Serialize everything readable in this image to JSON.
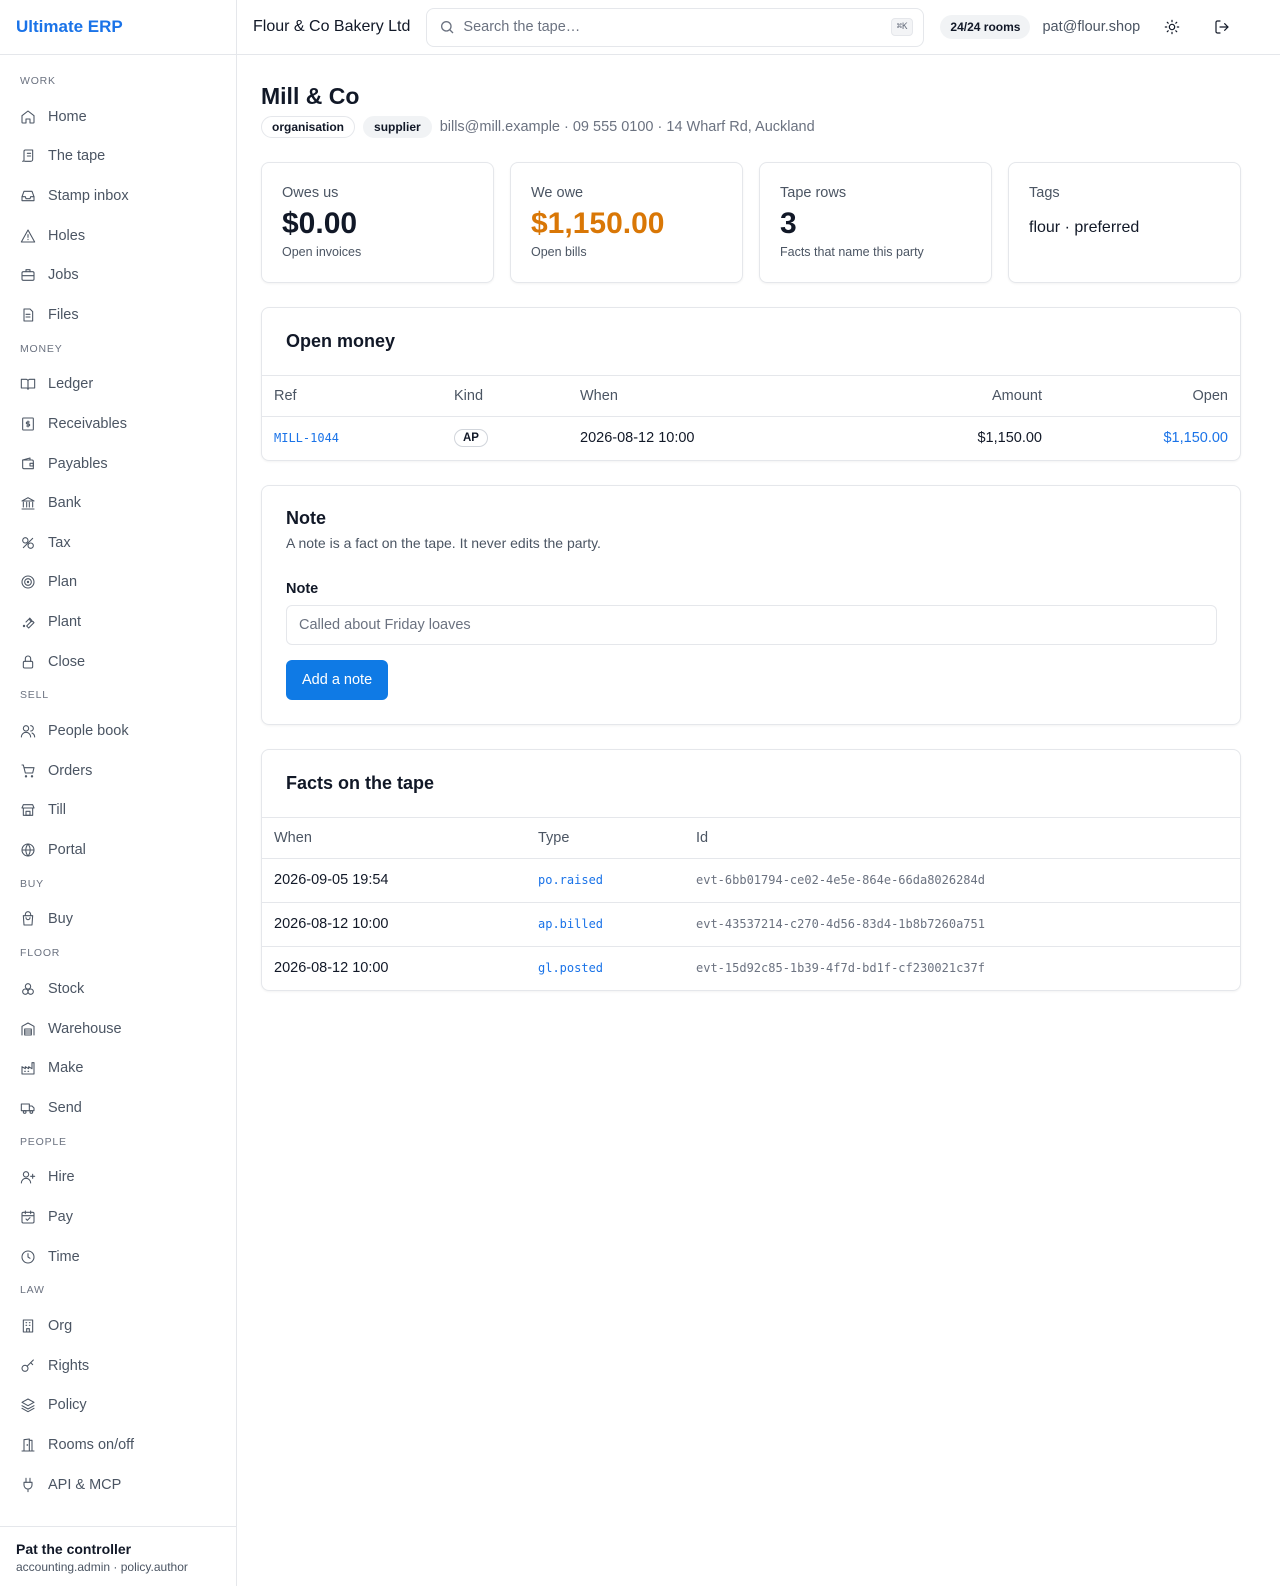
{
  "app": {
    "brand": "Ultimate ERP"
  },
  "topbar": {
    "company": "Flour & Co Bakery Ltd",
    "search_placeholder": "Search the tape…",
    "search_shortcut": "⌘K",
    "rooms_badge": "24/24 rooms",
    "email": "pat@flour.shop"
  },
  "sidebar": {
    "sections": [
      {
        "title": "WORK",
        "items": [
          {
            "label": "Home",
            "icon": "home-icon"
          },
          {
            "label": "The tape",
            "icon": "scroll-icon"
          },
          {
            "label": "Stamp inbox",
            "icon": "inbox-icon"
          },
          {
            "label": "Holes",
            "icon": "warning-triangle-icon"
          },
          {
            "label": "Jobs",
            "icon": "briefcase-icon"
          },
          {
            "label": "Files",
            "icon": "file-icon"
          }
        ]
      },
      {
        "title": "MONEY",
        "items": [
          {
            "label": "Ledger",
            "icon": "book-open-icon"
          },
          {
            "label": "Receivables",
            "icon": "receipt-dollar-icon"
          },
          {
            "label": "Payables",
            "icon": "wallet-icon"
          },
          {
            "label": "Bank",
            "icon": "bank-icon"
          },
          {
            "label": "Tax",
            "icon": "percent-icon"
          },
          {
            "label": "Plan",
            "icon": "target-icon"
          },
          {
            "label": "Plant",
            "icon": "wrench-icon"
          },
          {
            "label": "Close",
            "icon": "lock-icon"
          }
        ]
      },
      {
        "title": "SELL",
        "items": [
          {
            "label": "People book",
            "icon": "users-icon"
          },
          {
            "label": "Orders",
            "icon": "cart-icon"
          },
          {
            "label": "Till",
            "icon": "store-icon"
          },
          {
            "label": "Portal",
            "icon": "globe-icon"
          }
        ]
      },
      {
        "title": "BUY",
        "items": [
          {
            "label": "Buy",
            "icon": "shopping-bag-icon"
          }
        ]
      },
      {
        "title": "FLOOR",
        "items": [
          {
            "label": "Stock",
            "icon": "boxes-icon"
          },
          {
            "label": "Warehouse",
            "icon": "warehouse-icon"
          },
          {
            "label": "Make",
            "icon": "factory-icon"
          },
          {
            "label": "Send",
            "icon": "truck-icon"
          }
        ]
      },
      {
        "title": "PEOPLE",
        "items": [
          {
            "label": "Hire",
            "icon": "user-plus-icon"
          },
          {
            "label": "Pay",
            "icon": "calendar-check-icon"
          },
          {
            "label": "Time",
            "icon": "clock-icon"
          }
        ]
      },
      {
        "title": "LAW",
        "items": [
          {
            "label": "Org",
            "icon": "building-icon"
          },
          {
            "label": "Rights",
            "icon": "key-icon"
          },
          {
            "label": "Policy",
            "icon": "layers-icon"
          },
          {
            "label": "Rooms on/off",
            "icon": "door-icon"
          },
          {
            "label": "API & MCP",
            "icon": "plug-icon"
          }
        ]
      }
    ],
    "user": {
      "name": "Pat the controller",
      "roles": "accounting.admin · policy.author"
    }
  },
  "party": {
    "name": "Mill & Co",
    "badges": [
      "organisation",
      "supplier"
    ],
    "contact": "bills@mill.example · 09 555 0100 · 14 Wharf Rd, Auckland"
  },
  "cards": {
    "owes_us": {
      "label": "Owes us",
      "value": "$0.00",
      "sub": "Open invoices"
    },
    "we_owe": {
      "label": "We owe",
      "value": "$1,150.00",
      "sub": "Open bills"
    },
    "tape_rows": {
      "label": "Tape rows",
      "value": "3",
      "sub": "Facts that name this party"
    },
    "tags": {
      "label": "Tags",
      "value": "flour · preferred"
    }
  },
  "open_money": {
    "title": "Open money",
    "headers": {
      "ref": "Ref",
      "kind": "Kind",
      "when": "When",
      "amount": "Amount",
      "open": "Open"
    },
    "rows": [
      {
        "ref": "MILL-1044",
        "kind": "AP",
        "when": "2026-08-12 10:00",
        "amount": "$1,150.00",
        "open": "$1,150.00"
      }
    ]
  },
  "note": {
    "title": "Note",
    "description": "A note is a fact on the tape. It never edits the party.",
    "label": "Note",
    "placeholder": "Called about Friday loaves",
    "button": "Add a note"
  },
  "facts": {
    "title": "Facts on the tape",
    "headers": {
      "when": "When",
      "type": "Type",
      "id": "Id"
    },
    "rows": [
      {
        "when": "2026-09-05 19:54",
        "type": "po.raised",
        "id": "evt-6bb01794-ce02-4e5e-864e-66da8026284d"
      },
      {
        "when": "2026-08-12 10:00",
        "type": "ap.billed",
        "id": "evt-43537214-c270-4d56-83d4-1b8b7260a751"
      },
      {
        "when": "2026-08-12 10:00",
        "type": "gl.posted",
        "id": "evt-15d92c85-1b39-4f7d-bd1f-cf230021c37f"
      }
    ]
  },
  "colors": {
    "accent": "#1a73e8",
    "button": "#0f7ae5",
    "warning": "#d97706"
  }
}
